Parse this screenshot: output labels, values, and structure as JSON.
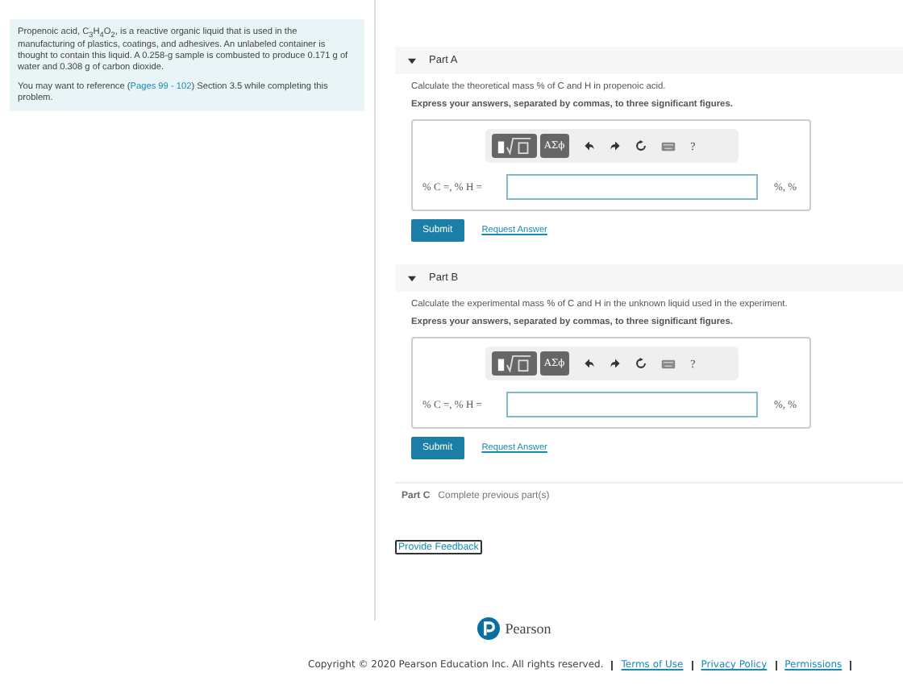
{
  "problem": {
    "intro": "Propenoic acid, C$_{3}$H$_{4}$O$_{2}$, is a reactive organic liquid that is used in the manufacturing of plastics, coatings, and adhesives. An unlabeled container is thought to contain this liquid. A 0.258-g sample is combusted to produce 0.171 g of water and 0.308 g of carbon dioxide.",
    "reference_before": "You may want to reference (",
    "reference_link": "Pages 99 - 102",
    "reference_after": ") Section 3.5 while completing this problem."
  },
  "parts": [
    {
      "kind": "question",
      "label": "Part A",
      "expanded": true,
      "question": "Calculate the theoretical mass % of C and H in propenoic acid.",
      "instruction": "Express your answers, separated by commas, to three significant figures.",
      "symbols_button": "ΑΣϕ",
      "help_button": "?",
      "answer_label": "% C =, % H =",
      "units": "%, %",
      "submit": "Submit",
      "request": "Request Answer"
    },
    {
      "kind": "question",
      "label": "Part B",
      "expanded": true,
      "question": "Calculate the experimental mass % of C and H in the unknown liquid used in the experiment.",
      "instruction": "Express your answers, separated by commas, to three significant figures.",
      "symbols_button": "ΑΣϕ",
      "help_button": "?",
      "answer_label": "% C =, % H =",
      "units": "%, %",
      "submit": "Submit",
      "request": "Request Answer"
    },
    {
      "kind": "locked",
      "label": "Part C",
      "status": "Complete previous part(s)"
    }
  ],
  "feedback_link": "Provide Feedback",
  "footer": {
    "logo_text": "Pearson",
    "copyright": "Copyright © 2020 Pearson Education Inc. All rights reserved.",
    "links": [
      "Terms of Use",
      "Privacy Policy",
      "Permissions"
    ]
  }
}
